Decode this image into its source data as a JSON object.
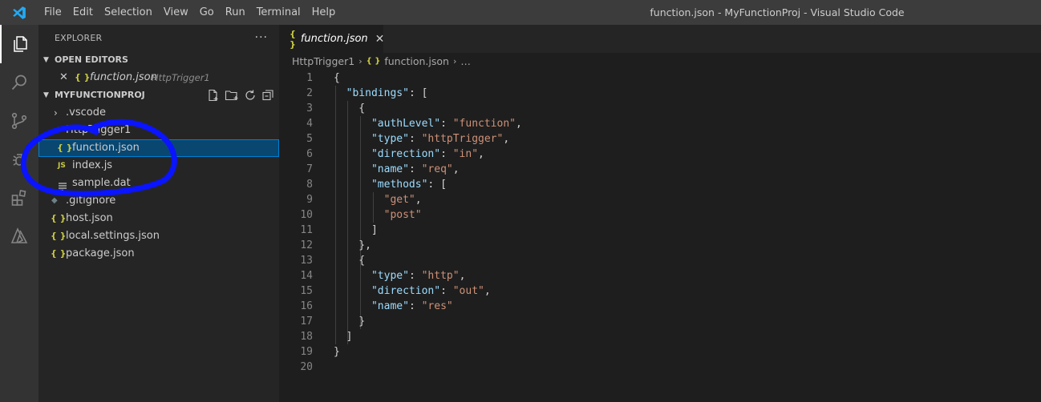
{
  "menu": {
    "items": [
      "File",
      "Edit",
      "Selection",
      "View",
      "Go",
      "Run",
      "Terminal",
      "Help"
    ]
  },
  "window_title": "function.json - MyFunctionProj - Visual Studio Code",
  "activity_bar": {
    "icons": [
      "explorer-icon",
      "search-icon",
      "source-control-icon",
      "debug-icon",
      "extensions-icon",
      "azure-icon"
    ]
  },
  "sidebar": {
    "title": "EXPLORER",
    "more": "···",
    "open_editors": {
      "header": "OPEN EDITORS",
      "items": [
        {
          "label": "function.json",
          "description": "HttpTrigger1"
        }
      ]
    },
    "project": {
      "header": "MYFUNCTIONPROJ",
      "items": [
        {
          "label": ".vscode"
        },
        {
          "label": "HttpTrigger1"
        },
        {
          "label": "function.json"
        },
        {
          "label": "index.js"
        },
        {
          "label": "sample.dat"
        },
        {
          "label": ".gitignore"
        },
        {
          "label": "host.json"
        },
        {
          "label": "local.settings.json"
        },
        {
          "label": "package.json"
        }
      ]
    },
    "icon_glyphs": {
      "json": "{ }",
      "js": "JS"
    }
  },
  "tab": {
    "label": "function.json",
    "close": "✕"
  },
  "breadcrumbs": {
    "folder": "HttpTrigger1",
    "file": "function.json",
    "trail": "…"
  },
  "editor": {
    "line_numbers": [
      "1",
      "2",
      "3",
      "4",
      "5",
      "6",
      "7",
      "8",
      "9",
      "10",
      "11",
      "12",
      "13",
      "14",
      "15",
      "16",
      "17",
      "18",
      "19",
      "20"
    ],
    "lines": [
      {
        "p": [
          "{"
        ]
      },
      {
        "p": [
          "  ",
          "\"bindings\"",
          ": ["
        ]
      },
      {
        "p": [
          "    {"
        ]
      },
      {
        "p": [
          "      ",
          "\"authLevel\"",
          ": ",
          "\"function\"",
          ","
        ]
      },
      {
        "p": [
          "      ",
          "\"type\"",
          ": ",
          "\"httpTrigger\"",
          ","
        ]
      },
      {
        "p": [
          "      ",
          "\"direction\"",
          ": ",
          "\"in\"",
          ","
        ]
      },
      {
        "p": [
          "      ",
          "\"name\"",
          ": ",
          "\"req\"",
          ","
        ]
      },
      {
        "p": [
          "      ",
          "\"methods\"",
          ": ["
        ]
      },
      {
        "p": [
          "        ",
          "\"get\"",
          ","
        ]
      },
      {
        "p": [
          "        ",
          "\"post\""
        ]
      },
      {
        "p": [
          "      ]"
        ]
      },
      {
        "p": [
          "    },"
        ]
      },
      {
        "p": [
          "    {"
        ]
      },
      {
        "p": [
          "      ",
          "\"type\"",
          ": ",
          "\"http\"",
          ","
        ]
      },
      {
        "p": [
          "      ",
          "\"direction\"",
          ": ",
          "\"out\"",
          ","
        ]
      },
      {
        "p": [
          "      ",
          "\"name\"",
          ": ",
          "\"res\""
        ]
      },
      {
        "p": [
          "    }"
        ]
      },
      {
        "p": [
          "  ]"
        ]
      },
      {
        "p": [
          "}"
        ]
      },
      {
        "p": [
          ""
        ]
      }
    ]
  },
  "colors": {
    "accent": "#007acc",
    "selection": "#094771",
    "annotation": "#0a14ff",
    "json_icon": "#cbcb41",
    "key": "#9cdcfe",
    "string": "#ce9178"
  }
}
